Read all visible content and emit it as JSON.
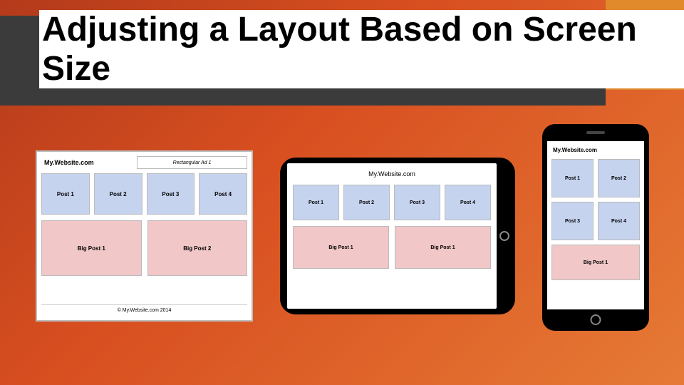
{
  "title": "Adjusting a Layout Based on Screen Size",
  "brand": "My.Website.com",
  "ad": "Rectangular Ad 1",
  "posts": {
    "p1": "Post 1",
    "p2": "Post 2",
    "p3": "Post 3",
    "p4": "Post 4"
  },
  "bigs": {
    "b1": "Big Post 1",
    "b2": "Big Post 2"
  },
  "tablet_bigs": {
    "b1": "Big Post 1",
    "b2": "Big Post 1"
  },
  "phone_big": "Big Post 1",
  "footer": "© My.Website.com 2014"
}
